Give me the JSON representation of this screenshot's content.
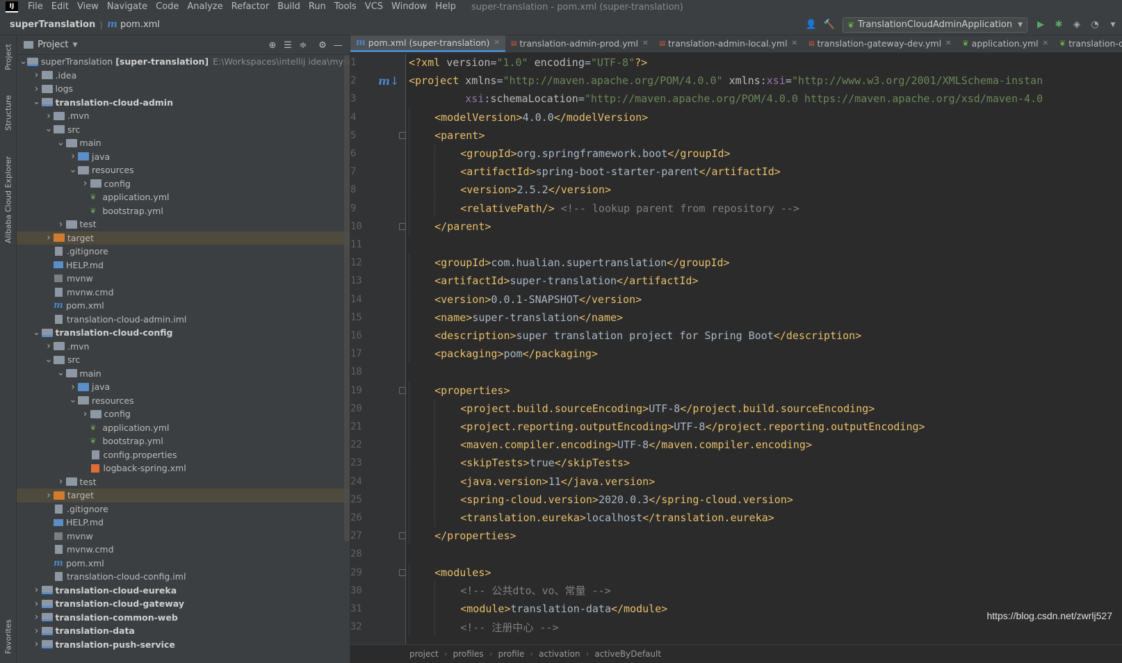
{
  "menubar": {
    "logo": "IJ",
    "items": [
      "File",
      "Edit",
      "View",
      "Navigate",
      "Code",
      "Analyze",
      "Refactor",
      "Build",
      "Run",
      "Tools",
      "VCS",
      "Window",
      "Help"
    ],
    "window_title": "super-translation - pom.xml (super-translation)"
  },
  "navbar": {
    "project": "superTranslation",
    "file": "pom.xml",
    "run_config": "TranslationCloudAdminApplication"
  },
  "left_strip": {
    "tabs": [
      "Project",
      "Structure",
      "Alibaba Cloud Explorer",
      "Favorites"
    ]
  },
  "project_panel": {
    "title": "Project",
    "tree": [
      {
        "depth": 0,
        "arrow": "down",
        "icon": "module",
        "label": "superTranslation",
        "suffix": "[super-translation]",
        "path": "E:\\Workspaces\\intellij idea\\myself\\supe",
        "bold": false
      },
      {
        "depth": 1,
        "arrow": "right",
        "icon": "folder",
        "label": ".idea"
      },
      {
        "depth": 1,
        "arrow": "right",
        "icon": "folder",
        "label": "logs"
      },
      {
        "depth": 1,
        "arrow": "down",
        "icon": "module",
        "label": "translation-cloud-admin",
        "bold": true
      },
      {
        "depth": 2,
        "arrow": "right",
        "icon": "folder",
        "label": ".mvn"
      },
      {
        "depth": 2,
        "arrow": "down",
        "icon": "folder",
        "label": "src"
      },
      {
        "depth": 3,
        "arrow": "down",
        "icon": "folder",
        "label": "main"
      },
      {
        "depth": 4,
        "arrow": "right",
        "icon": "folder-blue",
        "label": "java"
      },
      {
        "depth": 4,
        "arrow": "down",
        "icon": "folder",
        "label": "resources"
      },
      {
        "depth": 5,
        "arrow": "right",
        "icon": "folder",
        "label": "config"
      },
      {
        "depth": 5,
        "arrow": "",
        "icon": "yml",
        "label": "application.yml"
      },
      {
        "depth": 5,
        "arrow": "",
        "icon": "yml",
        "label": "bootstrap.yml"
      },
      {
        "depth": 3,
        "arrow": "right",
        "icon": "folder",
        "label": "test"
      },
      {
        "depth": 2,
        "arrow": "right",
        "icon": "folder-orange",
        "label": "target",
        "hl": true
      },
      {
        "depth": 2,
        "arrow": "",
        "icon": "generic",
        "label": ".gitignore"
      },
      {
        "depth": 2,
        "arrow": "",
        "icon": "md",
        "label": "HELP.md"
      },
      {
        "depth": 2,
        "arrow": "",
        "icon": "term",
        "label": "mvnw"
      },
      {
        "depth": 2,
        "arrow": "",
        "icon": "generic",
        "label": "mvnw.cmd"
      },
      {
        "depth": 2,
        "arrow": "",
        "icon": "m",
        "label": "pom.xml"
      },
      {
        "depth": 2,
        "arrow": "",
        "icon": "generic",
        "label": "translation-cloud-admin.iml"
      },
      {
        "depth": 1,
        "arrow": "down",
        "icon": "module",
        "label": "translation-cloud-config",
        "bold": true
      },
      {
        "depth": 2,
        "arrow": "right",
        "icon": "folder",
        "label": ".mvn"
      },
      {
        "depth": 2,
        "arrow": "down",
        "icon": "folder",
        "label": "src"
      },
      {
        "depth": 3,
        "arrow": "down",
        "icon": "folder",
        "label": "main"
      },
      {
        "depth": 4,
        "arrow": "right",
        "icon": "folder-blue",
        "label": "java"
      },
      {
        "depth": 4,
        "arrow": "down",
        "icon": "folder",
        "label": "resources"
      },
      {
        "depth": 5,
        "arrow": "right",
        "icon": "folder",
        "label": "config"
      },
      {
        "depth": 5,
        "arrow": "",
        "icon": "yml",
        "label": "application.yml"
      },
      {
        "depth": 5,
        "arrow": "",
        "icon": "yml",
        "label": "bootstrap.yml"
      },
      {
        "depth": 5,
        "arrow": "",
        "icon": "generic",
        "label": "config.properties"
      },
      {
        "depth": 5,
        "arrow": "",
        "icon": "xml",
        "label": "logback-spring.xml"
      },
      {
        "depth": 3,
        "arrow": "right",
        "icon": "folder",
        "label": "test"
      },
      {
        "depth": 2,
        "arrow": "right",
        "icon": "folder-orange",
        "label": "target",
        "hl": true
      },
      {
        "depth": 2,
        "arrow": "",
        "icon": "generic",
        "label": ".gitignore"
      },
      {
        "depth": 2,
        "arrow": "",
        "icon": "md",
        "label": "HELP.md"
      },
      {
        "depth": 2,
        "arrow": "",
        "icon": "term",
        "label": "mvnw"
      },
      {
        "depth": 2,
        "arrow": "",
        "icon": "generic",
        "label": "mvnw.cmd"
      },
      {
        "depth": 2,
        "arrow": "",
        "icon": "m",
        "label": "pom.xml"
      },
      {
        "depth": 2,
        "arrow": "",
        "icon": "generic",
        "label": "translation-cloud-config.iml"
      },
      {
        "depth": 1,
        "arrow": "right",
        "icon": "module",
        "label": "translation-cloud-eureka",
        "bold": true
      },
      {
        "depth": 1,
        "arrow": "right",
        "icon": "module",
        "label": "translation-cloud-gateway",
        "bold": true
      },
      {
        "depth": 1,
        "arrow": "right",
        "icon": "module",
        "label": "translation-common-web",
        "bold": true
      },
      {
        "depth": 1,
        "arrow": "right",
        "icon": "module",
        "label": "translation-data",
        "bold": true
      },
      {
        "depth": 1,
        "arrow": "right",
        "icon": "module",
        "label": "translation-push-service",
        "bold": true
      }
    ]
  },
  "editor": {
    "tabs": [
      {
        "icon": "m",
        "label": "pom.xml (super-translation)",
        "active": true
      },
      {
        "icon": "yml",
        "label": "translation-admin-prod.yml"
      },
      {
        "icon": "yml",
        "label": "translation-admin-local.yml"
      },
      {
        "icon": "yml",
        "label": "translation-gateway-dev.yml"
      },
      {
        "icon": "leaf",
        "label": "application.yml"
      },
      {
        "icon": "leaf",
        "label": "translation-clou"
      }
    ],
    "lines": [
      {
        "n": "1",
        "indent": 0,
        "tokens": [
          [
            "t",
            "<?xml "
          ],
          [
            "a",
            "version"
          ],
          [
            "tx",
            "="
          ],
          [
            "v",
            "\"1.0\""
          ],
          [
            "tx",
            " "
          ],
          [
            "a",
            "encoding"
          ],
          [
            "tx",
            "="
          ],
          [
            "v",
            "\"UTF-8\""
          ],
          [
            "t",
            "?>"
          ]
        ]
      },
      {
        "n": "2",
        "indent": 0,
        "gm": true,
        "tokens": [
          [
            "t",
            "<project "
          ],
          [
            "a",
            "xmlns"
          ],
          [
            "tx",
            "="
          ],
          [
            "v",
            "\"http://maven.apache.org/POM/4.0.0\""
          ],
          [
            "tx",
            " "
          ],
          [
            "a",
            "xmlns"
          ],
          [
            "tx",
            ":"
          ],
          [
            "ns",
            "xsi"
          ],
          [
            "tx",
            "="
          ],
          [
            "v",
            "\"http://www.w3.org/2001/XMLSchema-instan"
          ]
        ]
      },
      {
        "n": "3",
        "indent": 0,
        "tokens": [
          [
            "tx",
            "         "
          ],
          [
            "ns",
            "xsi"
          ],
          [
            "tx",
            ":"
          ],
          [
            "a",
            "schemaLocation"
          ],
          [
            "tx",
            "="
          ],
          [
            "v",
            "\"http://maven.apache.org/POM/4.0.0 https://maven.apache.org/xsd/maven-4.0"
          ]
        ]
      },
      {
        "n": "4",
        "indent": 1,
        "tokens": [
          [
            "t",
            "<modelVersion>"
          ],
          [
            "tx",
            "4.0.0"
          ],
          [
            "t",
            "</modelVersion>"
          ]
        ]
      },
      {
        "n": "5",
        "indent": 1,
        "fold": true,
        "tokens": [
          [
            "t",
            "<parent>"
          ]
        ]
      },
      {
        "n": "6",
        "indent": 2,
        "tokens": [
          [
            "t",
            "<groupId>"
          ],
          [
            "tx",
            "org.springframework.boot"
          ],
          [
            "t",
            "</groupId>"
          ]
        ]
      },
      {
        "n": "7",
        "indent": 2,
        "tokens": [
          [
            "t",
            "<artifactId>"
          ],
          [
            "tx",
            "spring-boot-starter-parent"
          ],
          [
            "t",
            "</artifactId>"
          ]
        ]
      },
      {
        "n": "8",
        "indent": 2,
        "tokens": [
          [
            "t",
            "<version>"
          ],
          [
            "tx",
            "2.5.2"
          ],
          [
            "t",
            "</version>"
          ]
        ]
      },
      {
        "n": "9",
        "indent": 2,
        "tokens": [
          [
            "t",
            "<relativePath/>"
          ],
          [
            "tx",
            " "
          ],
          [
            "c",
            "<!-- lookup parent from repository -->"
          ]
        ]
      },
      {
        "n": "10",
        "indent": 1,
        "fold": true,
        "tokens": [
          [
            "t",
            "</parent>"
          ]
        ]
      },
      {
        "n": "11",
        "indent": 0,
        "tokens": []
      },
      {
        "n": "12",
        "indent": 1,
        "tokens": [
          [
            "t",
            "<groupId>"
          ],
          [
            "tx",
            "com.hualian.supertranslation"
          ],
          [
            "t",
            "</groupId>"
          ]
        ]
      },
      {
        "n": "13",
        "indent": 1,
        "tokens": [
          [
            "t",
            "<artifactId>"
          ],
          [
            "tx",
            "super-translation"
          ],
          [
            "t",
            "</artifactId>"
          ]
        ]
      },
      {
        "n": "14",
        "indent": 1,
        "tokens": [
          [
            "t",
            "<version>"
          ],
          [
            "tx",
            "0.0.1-SNAPSHOT"
          ],
          [
            "t",
            "</version>"
          ]
        ]
      },
      {
        "n": "15",
        "indent": 1,
        "tokens": [
          [
            "t",
            "<name>"
          ],
          [
            "tx",
            "super-translation"
          ],
          [
            "t",
            "</name>"
          ]
        ]
      },
      {
        "n": "16",
        "indent": 1,
        "tokens": [
          [
            "t",
            "<description>"
          ],
          [
            "tx",
            "super translation project for Spring Boot"
          ],
          [
            "t",
            "</description>"
          ]
        ]
      },
      {
        "n": "17",
        "indent": 1,
        "tokens": [
          [
            "t",
            "<packaging>"
          ],
          [
            "tx",
            "pom"
          ],
          [
            "t",
            "</packaging>"
          ]
        ]
      },
      {
        "n": "18",
        "indent": 0,
        "tokens": []
      },
      {
        "n": "19",
        "indent": 1,
        "fold": true,
        "tokens": [
          [
            "t",
            "<properties>"
          ]
        ]
      },
      {
        "n": "20",
        "indent": 2,
        "tokens": [
          [
            "t",
            "<project.build.sourceEncoding>"
          ],
          [
            "tx",
            "UTF-8"
          ],
          [
            "t",
            "</project.build.sourceEncoding>"
          ]
        ]
      },
      {
        "n": "21",
        "indent": 2,
        "tokens": [
          [
            "t",
            "<project.reporting.outputEncoding>"
          ],
          [
            "tx",
            "UTF-8"
          ],
          [
            "t",
            "</project.reporting.outputEncoding>"
          ]
        ]
      },
      {
        "n": "22",
        "indent": 2,
        "tokens": [
          [
            "t",
            "<maven.compiler.encoding>"
          ],
          [
            "tx",
            "UTF-8"
          ],
          [
            "t",
            "</maven.compiler.encoding>"
          ]
        ]
      },
      {
        "n": "23",
        "indent": 2,
        "tokens": [
          [
            "t",
            "<skipTests>"
          ],
          [
            "tx",
            "true"
          ],
          [
            "t",
            "</skipTests>"
          ]
        ]
      },
      {
        "n": "24",
        "indent": 2,
        "tokens": [
          [
            "t",
            "<java.version>"
          ],
          [
            "tx",
            "11"
          ],
          [
            "t",
            "</java.version>"
          ]
        ]
      },
      {
        "n": "25",
        "indent": 2,
        "tokens": [
          [
            "t",
            "<spring-cloud.version>"
          ],
          [
            "tx",
            "2020.0.3"
          ],
          [
            "t",
            "</spring-cloud.version>"
          ]
        ]
      },
      {
        "n": "26",
        "indent": 2,
        "tokens": [
          [
            "t",
            "<translation.eureka>"
          ],
          [
            "tx",
            "localhost"
          ],
          [
            "t",
            "</translation.eureka>"
          ]
        ]
      },
      {
        "n": "27",
        "indent": 1,
        "fold": true,
        "tokens": [
          [
            "t",
            "</properties>"
          ]
        ]
      },
      {
        "n": "28",
        "indent": 0,
        "tokens": []
      },
      {
        "n": "29",
        "indent": 1,
        "fold": true,
        "tokens": [
          [
            "t",
            "<modules>"
          ]
        ]
      },
      {
        "n": "30",
        "indent": 2,
        "tokens": [
          [
            "c",
            "<!-- 公共dto、vo、常量 -->"
          ]
        ]
      },
      {
        "n": "31",
        "indent": 2,
        "tokens": [
          [
            "t",
            "<module>"
          ],
          [
            "tx",
            "translation-data"
          ],
          [
            "t",
            "</module>"
          ]
        ]
      },
      {
        "n": "32",
        "indent": 2,
        "tokens": [
          [
            "c",
            "<!-- 注册中心 -->"
          ]
        ]
      }
    ],
    "breadcrumb": [
      "project",
      "profiles",
      "profile",
      "activation",
      "activeByDefault"
    ]
  },
  "watermark": "https://blog.csdn.net/zwrlj527",
  "colors": {
    "tag": "#e8bf6a",
    "attr": "#bababa",
    "value": "#6a8759",
    "comment": "#808080",
    "namespace": "#9876aa",
    "text": "#a9b7c6"
  }
}
